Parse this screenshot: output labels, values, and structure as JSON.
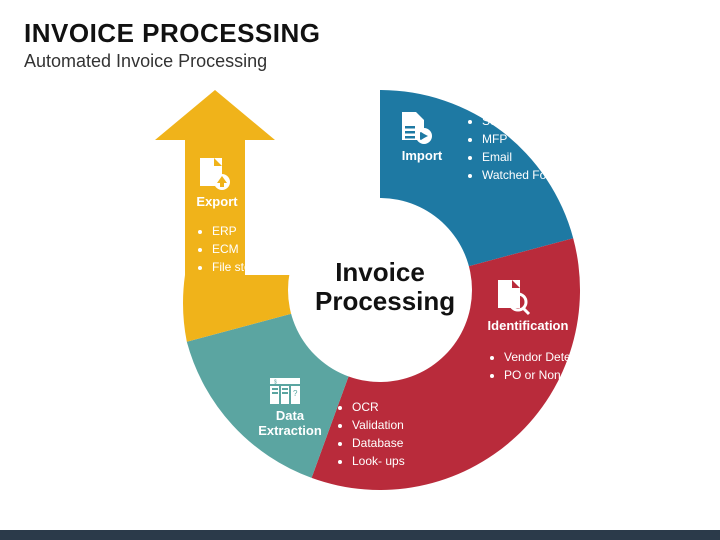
{
  "header": {
    "title": "INVOICE PROCESSING",
    "subtitle": "Automated Invoice Processing"
  },
  "center": {
    "line1": "Invoice",
    "line2": "Processing"
  },
  "segments": {
    "import": {
      "label": "Import",
      "items": [
        "Scanner",
        "MFP",
        "Email",
        "Watched Folder"
      ],
      "color": "#1e79a3"
    },
    "identification": {
      "label": "Identification",
      "items": [
        "Vendor Detection",
        "PO or Non-PO"
      ],
      "color": "#b92b3b"
    },
    "extraction": {
      "label": "Data Extraction",
      "items": [
        "OCR",
        "Validation",
        "Database",
        "Look- ups"
      ],
      "color": "#5ba5a1"
    },
    "export": {
      "label": "Export",
      "items": [
        "ERP",
        "ECM",
        "File storage"
      ],
      "color": "#f0b31a"
    }
  }
}
